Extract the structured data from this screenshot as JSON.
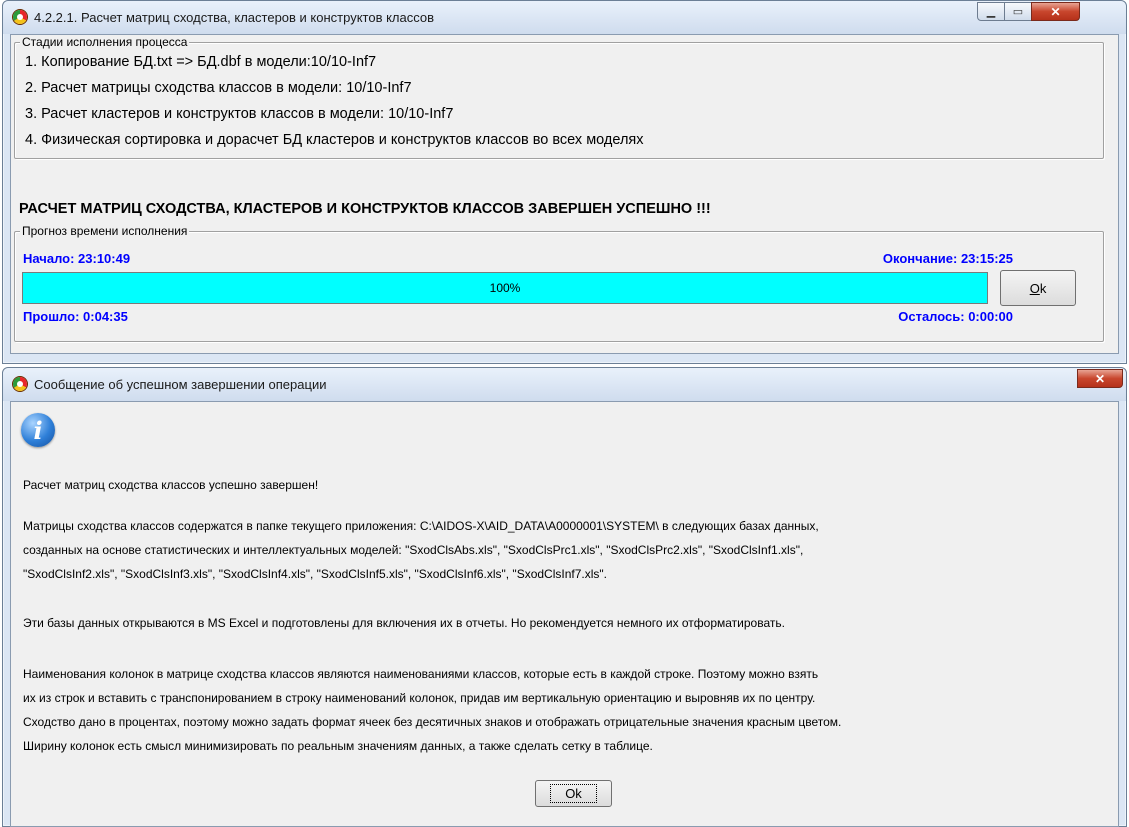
{
  "progress_window": {
    "title": "4.2.2.1. Расчет матриц сходства, кластеров и конструктов классов",
    "stages_group_label": "Стадии исполнения процесса",
    "stages": [
      "1. Копирование БД.txt => БД.dbf в модели:10/10-Inf7",
      "2. Расчет матрицы сходства классов в модели: 10/10-Inf7",
      "3. Расчет кластеров и конструктов классов в модели: 10/10-Inf7",
      "4. Физическая сортировка и дорасчет БД кластеров и конструктов классов во всех моделях"
    ],
    "success_heading": "РАСЧЕТ МАТРИЦ СХОДСТВА, КЛАСТЕРОВ И КОНСТРУКТОВ КЛАССОВ ЗАВЕРШЕН УСПЕШНО !!!",
    "time_group_label": "Прогноз времени исполнения",
    "start_label": "Начало: 23:10:49",
    "end_label": "Окончание: 23:15:25",
    "elapsed_label": "Прошло: 0:04:35",
    "remaining_label": "Осталось: 0:00:00",
    "progress_value": 1.0,
    "progress_text": "100%",
    "ok_button": "Ok"
  },
  "message_window": {
    "title": "Сообщение об успешном завершении операции",
    "lines": [
      "Расчет матриц сходства классов успешно завершен!",
      "Матрицы сходства классов содержатся в папке текущего приложения: C:\\AIDOS-X\\AID_DATA\\A0000001\\SYSTEM\\ в следующих базах данных,",
      "созданных на основе статистических и интеллектуальных моделей: \"SxodClsAbs.xls\", \"SxodClsPrc1.xls\", \"SxodClsPrc2.xls\", \"SxodClsInf1.xls\",",
      "\"SxodClsInf2.xls\", \"SxodClsInf3.xls\", \"SxodClsInf4.xls\", \"SxodClsInf5.xls\", \"SxodClsInf6.xls\", \"SxodClsInf7.xls\".",
      "Эти базы данных открываются в MS Excel и подготовлены для включения их в отчеты. Но рекомендуется немного их отформатировать.",
      "Наименования колонок в матрице сходства классов являются наименованиями классов, которые есть в каждой строке. Поэтому можно взять",
      "их из строк и вставить с транспонированием в строку наименований колонок, придав им вертикальную ориентацию и выровняв их по центру.",
      "Сходство дано в процентах, поэтому можно задать формат ячеек без десятичных знаков и отображать отрицательные значения красным цветом.",
      "Ширину колонок есть смысл минимизировать по реальным значениям данных, а также сделать сетку в таблице."
    ],
    "info_icon_glyph": "i",
    "ok_button": "Ok"
  },
  "colors": {
    "progress_fill": "#00ffff",
    "label_blue": "#0000ff",
    "close_button": "#c8462d"
  }
}
